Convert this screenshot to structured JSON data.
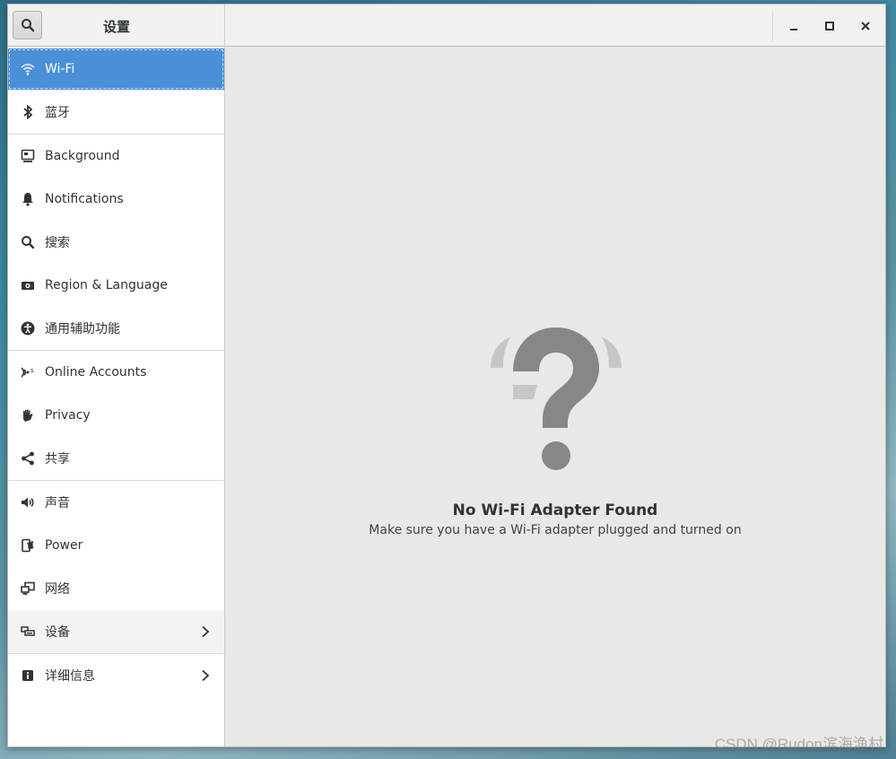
{
  "window": {
    "title": "设置"
  },
  "sidebar": {
    "items": [
      {
        "label": "Wi-Fi",
        "icon": "wifi-icon"
      },
      {
        "label": "蓝牙",
        "icon": "bluetooth-icon"
      },
      {
        "label": "Background",
        "icon": "background-icon"
      },
      {
        "label": "Notifications",
        "icon": "bell-icon"
      },
      {
        "label": "搜索",
        "icon": "search-icon"
      },
      {
        "label": "Region & Language",
        "icon": "camera-icon"
      },
      {
        "label": "通用辅助功能",
        "icon": "accessibility-icon"
      },
      {
        "label": "Online Accounts",
        "icon": "online-accounts-icon"
      },
      {
        "label": "Privacy",
        "icon": "hand-icon"
      },
      {
        "label": "共享",
        "icon": "share-icon"
      },
      {
        "label": "声音",
        "icon": "speaker-icon"
      },
      {
        "label": "Power",
        "icon": "power-icon"
      },
      {
        "label": "网络",
        "icon": "network-icon"
      },
      {
        "label": "设备",
        "icon": "devices-icon"
      },
      {
        "label": "详细信息",
        "icon": "info-icon"
      }
    ]
  },
  "main": {
    "title": "No Wi-Fi Adapter Found",
    "subtitle": "Make sure you have a Wi-Fi adapter plugged and turned on"
  },
  "watermark": "CSDN @Rudon滨海渔村",
  "colors": {
    "accent": "#4a90d9",
    "content_bg": "#e8e8e7",
    "icon_gray": "#888a85"
  }
}
